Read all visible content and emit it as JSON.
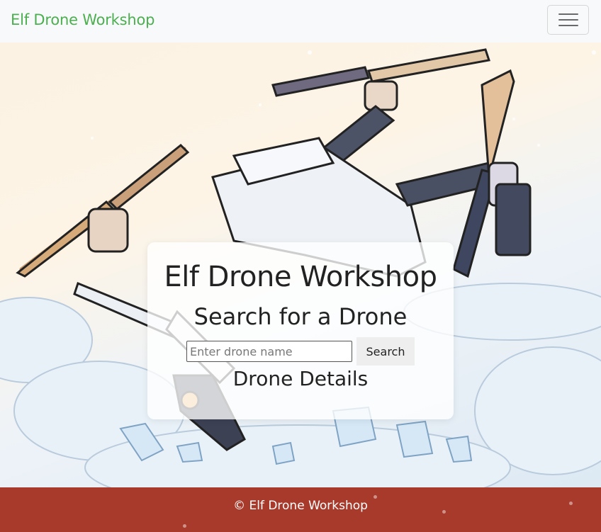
{
  "navbar": {
    "brand": "Elf Drone Workshop",
    "toggler_icon": "hamburger-menu-icon"
  },
  "card": {
    "title": "Elf Drone Workshop",
    "subtitle": "Search for a Drone",
    "search_placeholder": "Enter drone name",
    "search_value": "",
    "search_button": "Search",
    "details_heading": "Drone Details"
  },
  "footer": {
    "text": "© Elf Drone Workshop"
  },
  "colors": {
    "brand": "#4caf50",
    "footer_bg": "#a83a2c",
    "navbar_bg": "#f8f9fa"
  }
}
